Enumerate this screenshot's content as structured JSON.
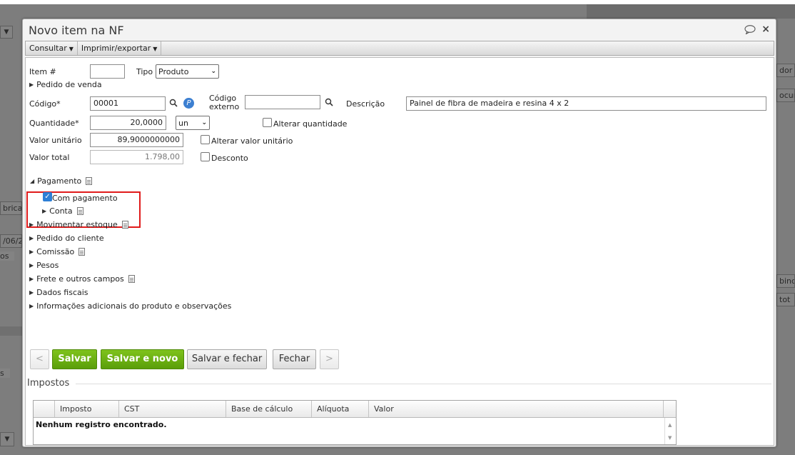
{
  "background": {
    "fragments": [
      "dor",
      "ocum",
      "brica",
      "/06/2",
      "os",
      "bindo",
      "tot",
      "s"
    ]
  },
  "modal": {
    "title": "Novo item na NF",
    "tools": {
      "comment_icon": "speech-bubble-icon",
      "close": "×"
    }
  },
  "toolbar": {
    "consultar": "Consultar",
    "imprimir": "Imprimir/exportar"
  },
  "form": {
    "item_label": "Item #",
    "item_value": "",
    "tipo_label": "Tipo",
    "tipo_value": "Produto",
    "pedido_venda": "Pedido de venda",
    "codigo_label": "Código*",
    "codigo_value": "00001",
    "codigo_externo_label_1": "Código",
    "codigo_externo_label_2": "externo",
    "codigo_externo_value": "",
    "descricao_label": "Descrição",
    "descricao_value": "Painel de fibra de madeira e resina 4 x 2",
    "quantidade_label": "Quantidade*",
    "quantidade_value": "20,0000",
    "unidade_value": "un",
    "alterar_quantidade": "Alterar quantidade",
    "valor_unitario_label": "Valor unitário",
    "valor_unitario_value": "89,9000000000",
    "alterar_valor_unitario": "Alterar valor unitário",
    "valor_total_label": "Valor total",
    "valor_total_value": "1.798,00",
    "desconto": "Desconto"
  },
  "sections": {
    "pagamento": "Pagamento",
    "com_pagamento": "Com pagamento",
    "conta": "Conta",
    "movimentar_estoque": "Movimentar estoque",
    "pedido_cliente": "Pedido do cliente",
    "comissao": "Comissão",
    "pesos": "Pesos",
    "frete": "Frete e outros campos",
    "dados_fiscais": "Dados fiscais",
    "info_adicionais": "Informações adicionais do produto e observações"
  },
  "buttons": {
    "prev": "<",
    "salvar": "Salvar",
    "salvar_novo": "Salvar e novo",
    "salvar_fechar": "Salvar e fechar",
    "fechar": "Fechar",
    "next": ">"
  },
  "impostos": {
    "title": "Impostos",
    "columns": [
      "",
      "Imposto",
      "CST",
      "Base de cálculo",
      "Alíquota",
      "Valor"
    ],
    "empty": "Nenhum registro encontrado."
  },
  "colors": {
    "green": "#5a9e0a",
    "highlight": "#e01b1b",
    "checkbox": "#2d7fd6"
  }
}
